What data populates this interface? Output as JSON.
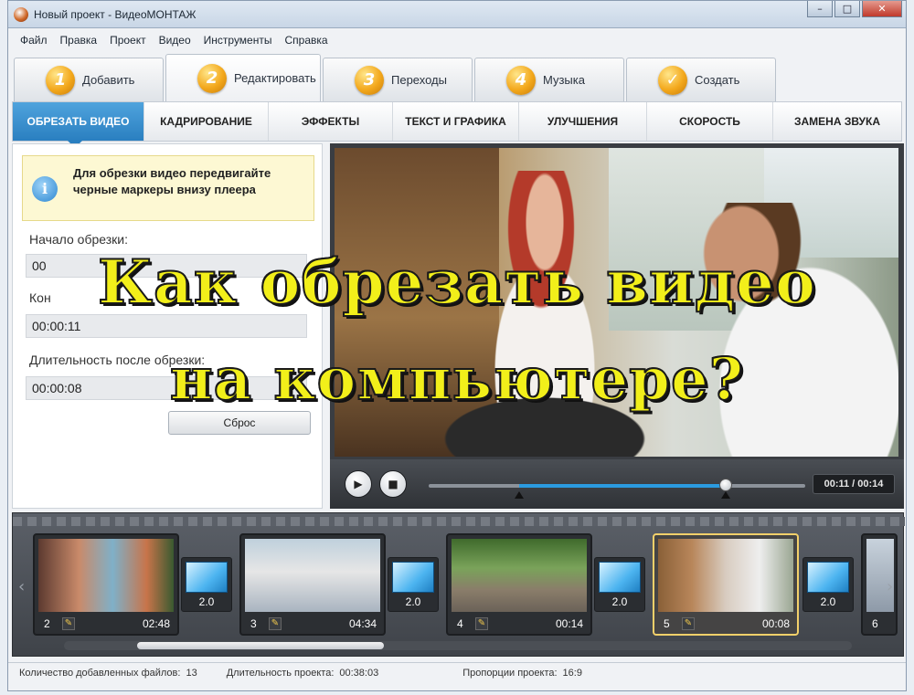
{
  "window": {
    "title": "Новый проект - ВидеоМОНТАЖ",
    "controls": [
      "–",
      "□",
      "✕"
    ]
  },
  "menu": [
    "Файл",
    "Правка",
    "Проект",
    "Видео",
    "Инструменты",
    "Справка"
  ],
  "main_tabs": [
    {
      "num": "1",
      "label": "Добавить"
    },
    {
      "num": "2",
      "label": "Редактировать"
    },
    {
      "num": "3",
      "label": "Переходы"
    },
    {
      "num": "4",
      "label": "Музыка"
    },
    {
      "num": "✓",
      "label": "Создать"
    }
  ],
  "sub_tabs": [
    "ОБРЕЗАТЬ ВИДЕО",
    "КАДРИРОВАНИЕ",
    "ЭФФЕКТЫ",
    "ТЕКСТ И ГРАФИКА",
    "УЛУЧШЕНИЯ",
    "СКОРОСТЬ",
    "ЗАМЕНА ЗВУКА"
  ],
  "trim_panel": {
    "hint": "Для обрезки видео передвигайте черные маркеры внизу плеера",
    "start_label": "Начало обрезки:",
    "start_value": "00",
    "end_label": "Кон",
    "end_value": "00:00:11",
    "duration_label": "Длительность после обрезки:",
    "duration_value": "00:00:08",
    "reset": "Сброс"
  },
  "player": {
    "time": "00:11 / 00:14",
    "selection_start": 0.24,
    "selection_end": 0.79,
    "position": 0.79
  },
  "overlay": {
    "line1": "Как обрезать видео",
    "line2": "на компьютере?"
  },
  "timeline": {
    "clips": [
      {
        "num": "2",
        "duration": "02:48"
      },
      {
        "num": "3",
        "duration": "04:34"
      },
      {
        "num": "4",
        "duration": "00:14"
      },
      {
        "num": "5",
        "duration": "00:08"
      },
      {
        "num": "6",
        "duration": ""
      }
    ],
    "transitions": [
      "2.0",
      "2.0",
      "2.0",
      "2.0"
    ]
  },
  "status": {
    "files_label": "Количество добавленных файлов:",
    "files_value": "13",
    "duration_label": "Длительность проекта:",
    "duration_value": "00:38:03",
    "ratio_label": "Пропорции проекта:",
    "ratio_value": "16:9"
  }
}
